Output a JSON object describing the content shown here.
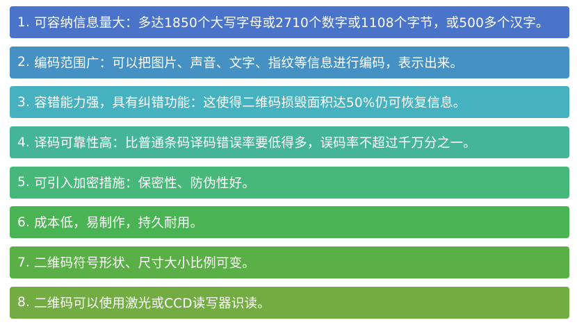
{
  "items": [
    {
      "num": "1.",
      "text": "可容纳信息量大：多达1850个大写字母或2710个数字或1108个字节，或500多个汉字。",
      "color": "#4a74c9"
    },
    {
      "num": "2.",
      "text": "编码范围广：可以把图片、声音、文字、指纹等信息进行编码，表示出来。",
      "color": "#4691c4"
    },
    {
      "num": "3.",
      "text": "容错能力强，具有纠错功能：这使得二维码损毁面积达50%仍可恢复信息。",
      "color": "#46b2bf"
    },
    {
      "num": "4.",
      "text": "译码可靠性高：比普通条码译码错误率要低得多，误码率不超过千万分之一。",
      "color": "#44b599"
    },
    {
      "num": "5.",
      "text": "可引入加密措施：保密性、防伪性好。",
      "color": "#47b879"
    },
    {
      "num": "6.",
      "text": "成本低，易制作，持久耐用。",
      "color": "#4ab354"
    },
    {
      "num": "7.",
      "text": "二维码符号形状、尺寸大小比例可变。",
      "color": "#5aaf47"
    },
    {
      "num": "8.",
      "text": "二维码可以使用激光或CCD读写器识读。",
      "color": "#72ac42"
    }
  ]
}
